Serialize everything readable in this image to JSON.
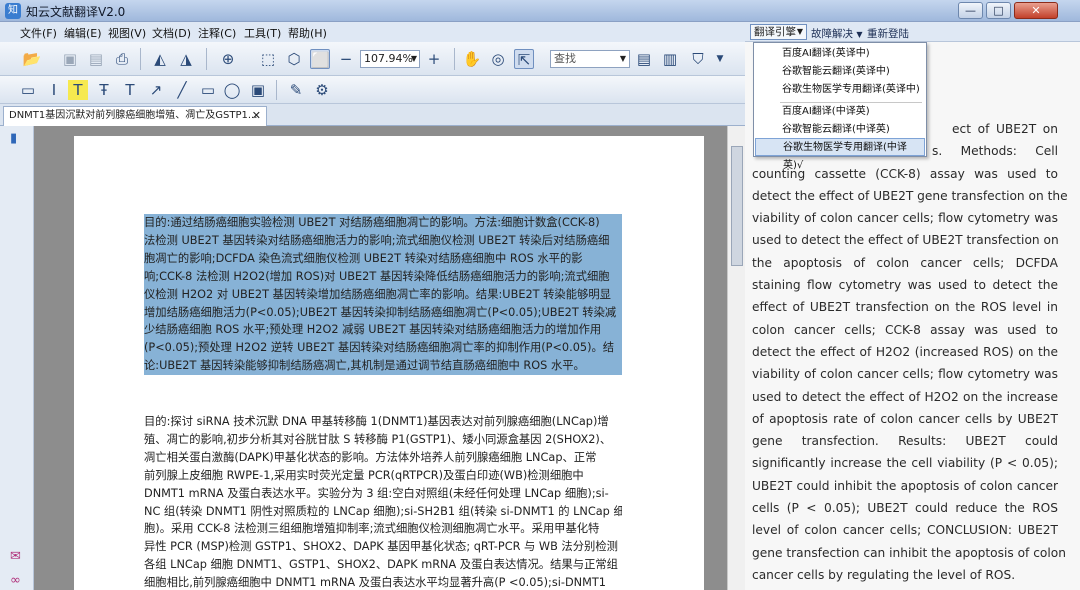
{
  "window": {
    "title": "知云文献翻译V2.0",
    "minimize": "—",
    "maximize": "□",
    "close": "✕"
  },
  "menu": [
    "文件(F)",
    "编辑(E)",
    "视图(V)",
    "文档(D)",
    "注释(C)",
    "工具(T)",
    "帮助(H)"
  ],
  "toolbar": {
    "zoom_value": "107.94%",
    "search_placeholder": "查找"
  },
  "tab": {
    "label": "DNMT1基因沉默对前列腺癌细胞增殖、凋亡及GSTP1...",
    "close": "✕"
  },
  "right_header": {
    "engine_label": "翻译引擎",
    "fault_label": "故障解决",
    "relogin_label": "重新登陆"
  },
  "engine_menu": {
    "items": [
      "百度AI翻译(英译中)",
      "谷歌智能云翻译(英译中)",
      "谷歌生物医学专用翻译(英译中)",
      "百度AI翻译(中译英)",
      "谷歌智能云翻译(中译英)",
      "谷歌生物医学专用翻译(中译英)√"
    ],
    "selected_index": 5
  },
  "document": {
    "highlighted_lines": [
      "目的:通过结肠癌细胞实验检测  UBE2T  对结肠癌细胞凋亡的影响。方法:细胞计数盒(CCK-8)",
      "法检测 UBE2T 基因转染对结肠癌细胞活力的影响;流式细胞仪检测 UBE2T 转染后对结肠癌细",
      "胞凋亡的影响;DCFDA  染色流式细胞仪检测  UBE2T  转染对结肠癌细胞中  ROS  水平的影",
      "响;CCK-8 法检测 H2O2(增加 ROS)对 UBE2T 基因转染降低结肠癌细胞活力的影响;流式细胞",
      "仪检测 H2O2 对 UBE2T 基因转染增加结肠癌细胞凋亡率的影响。结果:UBE2T 转染能够明显",
      "增加结肠癌细胞活力(P<0.05);UBE2T 基因转染抑制结肠癌细胞凋亡(P<0.05);UBE2T 转染减",
      "少结肠癌细胞 ROS 水平;预处理 H2O2 减弱 UBE2T 基因转染对结肠癌细胞活力的增加作用",
      "(P<0.05);预处理  H2O2  逆转  UBE2T  基因转染对结肠癌细胞凋亡率的抑制作用(P<0.05)。结",
      "论:UBE2T 基因转染能够抑制结肠癌凋亡,其机制是通过调节结直肠癌细胞中 ROS 水平。"
    ],
    "plain_lines": [
      "目的:探讨 siRNA 技术沉默 DNA 甲基转移酶 1(DNMT1)基因表达对前列腺癌细胞(LNCap)增",
      "殖、凋亡的影响,初步分析其对谷胱甘肽 S 转移酶 P1(GSTP1)、矮小同源盒基因 2(SHOX2)、",
      "凋亡相关蛋白激酶(DAPK)甲基化状态的影响。方法体外培养人前列腺癌细胞 LNCap、正常",
      "前列腺上皮细胞  RWPE-1,采用实时荧光定量  PCR(qRTPCR)及蛋白印迹(WB)检测细胞中",
      "DNMT1 mRNA 及蛋白表达水平。实验分为 3 组:空白对照组(未经任何处理 LNCap 细胞);si-",
      "NC 组(转染 DNMT1 阴性对照质粒的 LNCap 细胞);si-SH2B1 组(转染 si-DNMT1 的 LNCap 细",
      "胞)。采用 CCK-8 法检测三组细胞增殖抑制率;流式细胞仪检测细胞凋亡水平。采用甲基化特",
      "异性 PCR (MSP)检测 GSTP1、SHOX2、DAPK 基因甲基化状态; qRT-PCR 与 WB 法分别检测",
      "各组 LNCap 细胞 DNMT1、GSTP1、SHOX2、DAPK mRNA 及蛋白表达情况。结果与正常组",
      "细胞相比,前列腺癌细胞中 DNMT1 mRNA 及蛋白表达水平均显著升高(P <0.05);si-DNMT1"
    ]
  },
  "translation": {
    "first_line_tail": "ect of UBE2T on",
    "second_line_tail": "s. Methods: Cell",
    "lines": [
      "counting cassette (CCK-8) assay was used to",
      "detect the effect of UBE2T gene transfection on the",
      "viability of colon cancer cells; flow cytometry was",
      "used to detect the effect of UBE2T transfection on",
      "the apoptosis of colon cancer cells; DCFDA",
      "staining flow cytometry was used to detect the",
      "effect of UBE2T transfection on the ROS level in",
      "colon cancer cells; CCK-8 assay was used to",
      "detect the effect of H2O2 (increased ROS) on the",
      "viability of colon cancer cells; flow cytometry was",
      "used to detect the effect of H2O2 on the increase",
      "of apoptosis rate of colon cancer cells by UBE2T",
      "gene transfection. Results: UBE2T could",
      "significantly increase the cell viability (P < 0.05);",
      "UBE2T could inhibit the apoptosis of colon cancer",
      "cells (P < 0.05); UBE2T could reduce the ROS",
      "level of colon cancer cells; CONCLUSION: UBE2T",
      "gene transfection can inhibit the apoptosis of colon",
      "cancer cells by regulating the level of ROS."
    ]
  }
}
